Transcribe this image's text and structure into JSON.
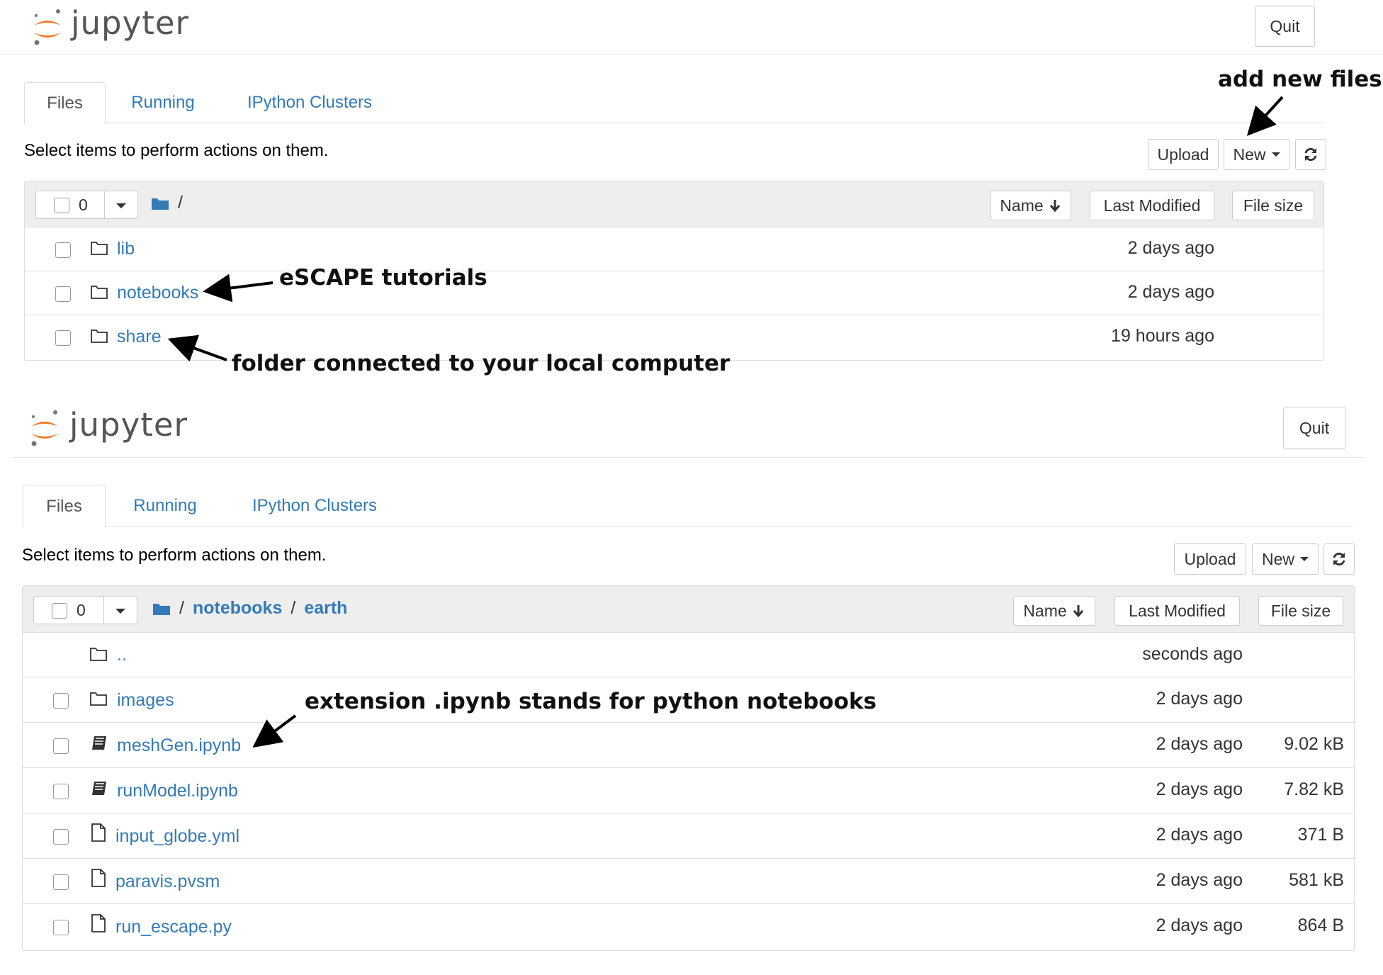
{
  "top": {
    "logo_text": "jupyter",
    "quit_label": "Quit",
    "tabs": [
      "Files",
      "Running",
      "IPython Clusters"
    ],
    "hint": "Select items to perform actions on them.",
    "upload_label": "Upload",
    "new_label": "New",
    "selected_count": "0",
    "breadcrumb": [
      "/"
    ],
    "sort_name": "Name",
    "sort_modified": "Last Modified",
    "sort_size": "File size",
    "rows": [
      {
        "name": "lib",
        "type": "folder",
        "modified": "2 days ago",
        "size": ""
      },
      {
        "name": "notebooks",
        "type": "folder",
        "modified": "2 days ago",
        "size": ""
      },
      {
        "name": "share",
        "type": "folder",
        "modified": "19 hours ago",
        "size": ""
      }
    ]
  },
  "bottom": {
    "logo_text": "jupyter",
    "quit_label": "Quit",
    "tabs": [
      "Files",
      "Running",
      "IPython Clusters"
    ],
    "hint": "Select items to perform actions on them.",
    "upload_label": "Upload",
    "new_label": "New",
    "selected_count": "0",
    "breadcrumb": [
      "notebooks",
      "earth"
    ],
    "sort_name": "Name",
    "sort_modified": "Last Modified",
    "sort_size": "File size",
    "rows": [
      {
        "name": "..",
        "type": "folder",
        "modified": "seconds ago",
        "size": ""
      },
      {
        "name": "images",
        "type": "folder",
        "modified": "2 days ago",
        "size": ""
      },
      {
        "name": "meshGen.ipynb",
        "type": "notebook",
        "modified": "2 days ago",
        "size": "9.02 kB"
      },
      {
        "name": "runModel.ipynb",
        "type": "notebook",
        "modified": "2 days ago",
        "size": "7.82 kB"
      },
      {
        "name": "input_globe.yml",
        "type": "file",
        "modified": "2 days ago",
        "size": "371 B"
      },
      {
        "name": "paravis.pvsm",
        "type": "file",
        "modified": "2 days ago",
        "size": "581 kB"
      },
      {
        "name": "run_escape.py",
        "type": "file",
        "modified": "2 days ago",
        "size": "864 B"
      }
    ]
  },
  "annotations": {
    "add_new_files": "add new files",
    "escape_tutorials": "eSCAPE tutorials",
    "folder_connected": "folder connected to your local computer",
    "ipynb_extension": "extension .ipynb stands for python notebooks"
  },
  "colors": {
    "link": "#337ab7",
    "header_bg": "#eeeeee",
    "border": "#dddddd",
    "logo_orange": "#f37726",
    "logo_gray": "#767677"
  }
}
